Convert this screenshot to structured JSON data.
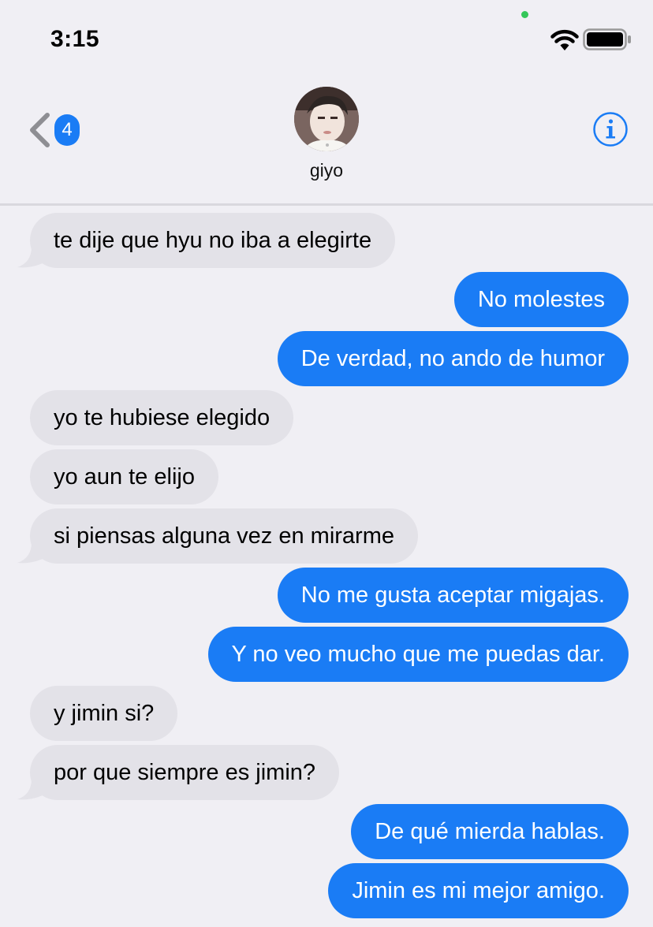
{
  "status_bar": {
    "time": "3:15",
    "icons": [
      "wifi-icon",
      "battery-icon"
    ],
    "indicator_color": "#34c759"
  },
  "nav": {
    "back_badge_count": "4",
    "contact_name": "giyo",
    "info_icon": "info-icon",
    "accent_color": "#1a7cf5"
  },
  "messages": [
    {
      "from": "them",
      "text": "te dije que hyu no iba a elegirte"
    },
    {
      "from": "me",
      "text": "No molestes"
    },
    {
      "from": "me",
      "text": "De verdad, no ando de humor"
    },
    {
      "from": "them",
      "text": "yo te hubiese elegido"
    },
    {
      "from": "them",
      "text": "yo aun te elijo"
    },
    {
      "from": "them",
      "text": "si piensas alguna vez en mirarme"
    },
    {
      "from": "me",
      "text": "No me gusta aceptar migajas."
    },
    {
      "from": "me",
      "text": "Y no veo mucho que me puedas dar."
    },
    {
      "from": "them",
      "text": "y jimin si?"
    },
    {
      "from": "them",
      "text": "por que siempre es jimin?"
    },
    {
      "from": "me",
      "text": "De qué mierda hablas."
    },
    {
      "from": "me",
      "text": "Jimin es mi mejor amigo."
    }
  ]
}
